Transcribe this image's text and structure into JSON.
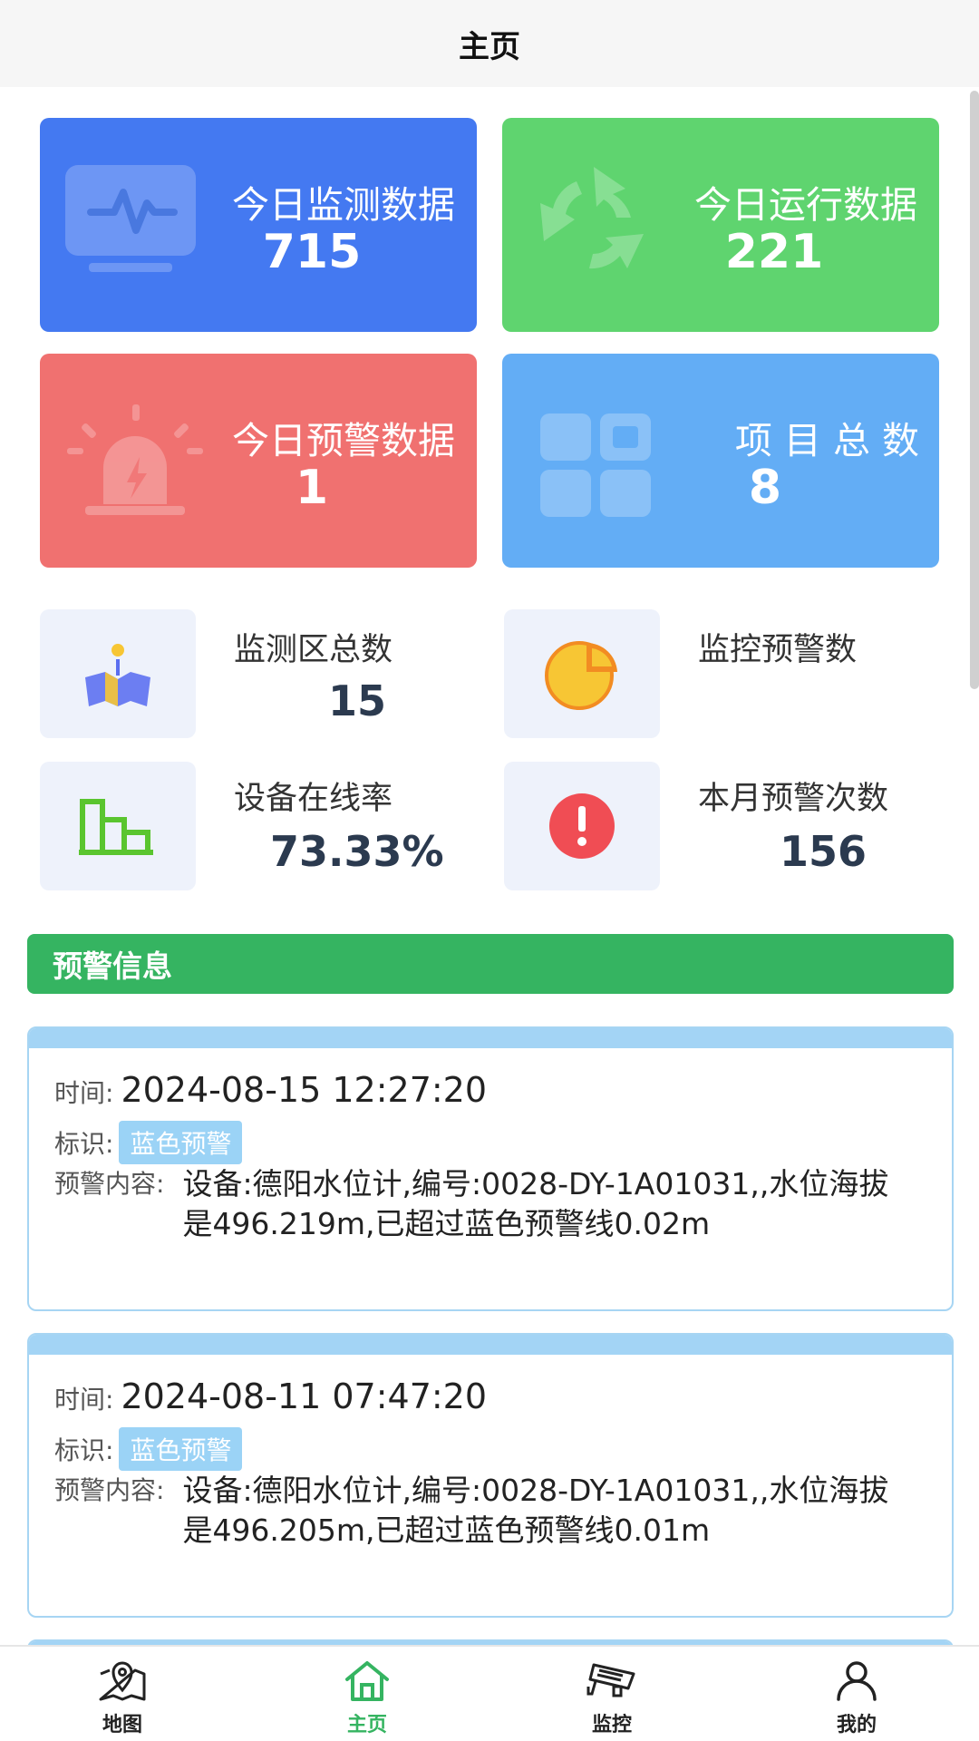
{
  "header": {
    "title": "主页"
  },
  "summary_cards": [
    {
      "title": "今日监测数据",
      "value": "715",
      "color": "#4479f1",
      "icon": "monitor-icon"
    },
    {
      "title": "今日运行数据",
      "value": "221",
      "color": "#5fd46f",
      "icon": "recycle-icon"
    },
    {
      "title": "今日预警数据",
      "value": "1",
      "color": "#f07170",
      "icon": "alarm-icon"
    },
    {
      "title": "项 目 总 数",
      "value": "8",
      "color": "#63adf5",
      "icon": "grid-icon"
    }
  ],
  "stats": [
    {
      "label": "监测区总数",
      "value": "15",
      "icon": "map-marker-icon"
    },
    {
      "label": "监控预警数",
      "value": "",
      "icon": "pie-chart-icon"
    },
    {
      "label": "设备在线率",
      "value": "73.33%",
      "icon": "bar-chart-icon"
    },
    {
      "label": "本月预警次数",
      "value": "156",
      "icon": "exclamation-icon"
    }
  ],
  "section": {
    "title": "预警信息"
  },
  "alerts": [
    {
      "time_label": "时间:",
      "time": "2024-08-15 12:27:20",
      "tag_label": "标识:",
      "tag": "蓝色预警",
      "content_label": "预警内容:",
      "content": "设备:德阳水位计,编号:0028-DY-1A01031,,水位海拔是496.219m,已超过蓝色预警线0.02m"
    },
    {
      "time_label": "时间:",
      "time": "2024-08-11 07:47:20",
      "tag_label": "标识:",
      "tag": "蓝色预警",
      "content_label": "预警内容:",
      "content": "设备:德阳水位计,编号:0028-DY-1A01031,,水位海拔是496.205m,已超过蓝色预警线0.01m"
    }
  ],
  "tabbar": [
    {
      "label": "地图",
      "icon": "map-pin-icon"
    },
    {
      "label": "主页",
      "icon": "home-icon",
      "active": true
    },
    {
      "label": "监控",
      "icon": "camera-icon"
    },
    {
      "label": "我的",
      "icon": "user-icon"
    }
  ],
  "colors": {
    "accent": "#35b461",
    "tag_blue": "#9bd3f6"
  }
}
